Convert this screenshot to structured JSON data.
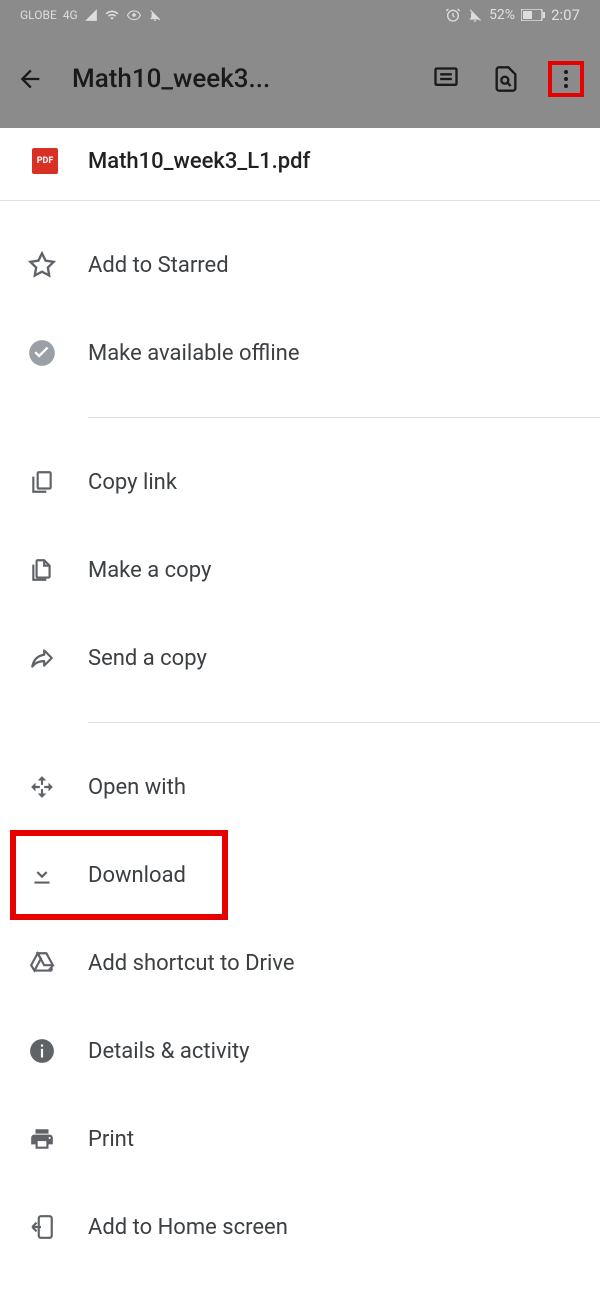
{
  "statusBar": {
    "carrier": "GLOBE",
    "network": "4G",
    "battery": "52%",
    "time": "2:07"
  },
  "appBar": {
    "title": "Math10_week3..."
  },
  "file": {
    "name": "Math10_week3_L1.pdf",
    "iconLabel": "PDF"
  },
  "menu": {
    "starred": "Add to Starred",
    "offline": "Make available offline",
    "copyLink": "Copy link",
    "makeCopy": "Make a copy",
    "sendCopy": "Send a copy",
    "openWith": "Open with",
    "download": "Download",
    "addShortcut": "Add shortcut to Drive",
    "details": "Details & activity",
    "print": "Print",
    "homeScreen": "Add to Home screen"
  }
}
